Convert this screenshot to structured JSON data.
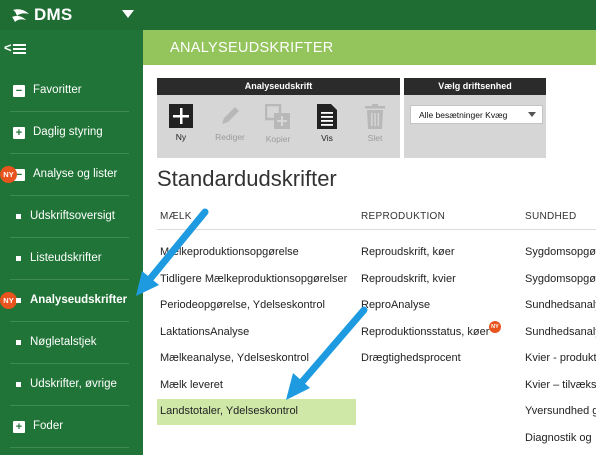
{
  "app": {
    "name": "DMS"
  },
  "sidebar": {
    "items": [
      {
        "label": "Favoritter",
        "icon": "minus-box-icon",
        "symbol": "−"
      },
      {
        "label": "Daglig styring",
        "icon": "plus-box-icon",
        "symbol": "+"
      },
      {
        "label": "Analyse og lister",
        "icon": "minus-box-icon",
        "symbol": "−",
        "badge": "NY"
      },
      {
        "label": "Udskriftsoversigt",
        "icon": "bullet-icon"
      },
      {
        "label": "Listeudskrifter",
        "icon": "bullet-icon"
      },
      {
        "label": "Analyseudskrifter",
        "icon": "bullet-icon",
        "badge": "NY",
        "active": true
      },
      {
        "label": "Nøgletalstjek",
        "icon": "bullet-icon"
      },
      {
        "label": "Udskrifter, øvrige",
        "icon": "bullet-icon"
      },
      {
        "label": "Foder",
        "icon": "plus-box-icon",
        "symbol": "+"
      }
    ]
  },
  "page": {
    "title": "ANALYSEUDSKRIFTER"
  },
  "toolbar": {
    "group1_title": "Analyseudskrift",
    "ny": "Ny",
    "rediger": "Rediger",
    "kopier": "Kopier",
    "vis": "Vis",
    "slet": "Slet",
    "group2_title": "Vælg driftsenhed",
    "driftsenhed_value": "Alle besætninger Kvæg"
  },
  "main": {
    "section_title": "Standardudskrifter",
    "columns": {
      "maelk": "MÆLK",
      "reproduktion": "REPRODUKTION",
      "sundhed": "SUNDHED"
    },
    "maelk": [
      "Mælkeproduktionsopgørelse",
      "Tidligere Mælkeproduktionsopgørelser",
      "Periodeopgørelse, Ydelseskontrol",
      "LaktationsAnalyse",
      "Mælkeanalyse, Ydelseskontrol",
      "Mælk leveret",
      "Landstotaler, Ydelseskontrol"
    ],
    "reproduktion": [
      "Reproudskrift, køer",
      "Reproudskrift, kvier",
      "ReproAnalyse",
      "Reproduktionsstatus, køer",
      "Drægtighedsprocent"
    ],
    "sundhed": [
      "Sygdomsopgø",
      "Sygdomsopgø",
      "Sundhedsanaly",
      "Sundhedsanaly",
      "Kvier - produkt",
      "Kvier – tilvækst",
      "Yversundhed g",
      "Diagnostik og"
    ],
    "reproduktion_badge": "NY"
  },
  "colors": {
    "sidebar": "#207437",
    "topbar": "#1f6d33",
    "header": "#94c45c",
    "highlight": "#cfe8a8",
    "badge": "#e8541e",
    "arrow": "#1e9be0"
  }
}
